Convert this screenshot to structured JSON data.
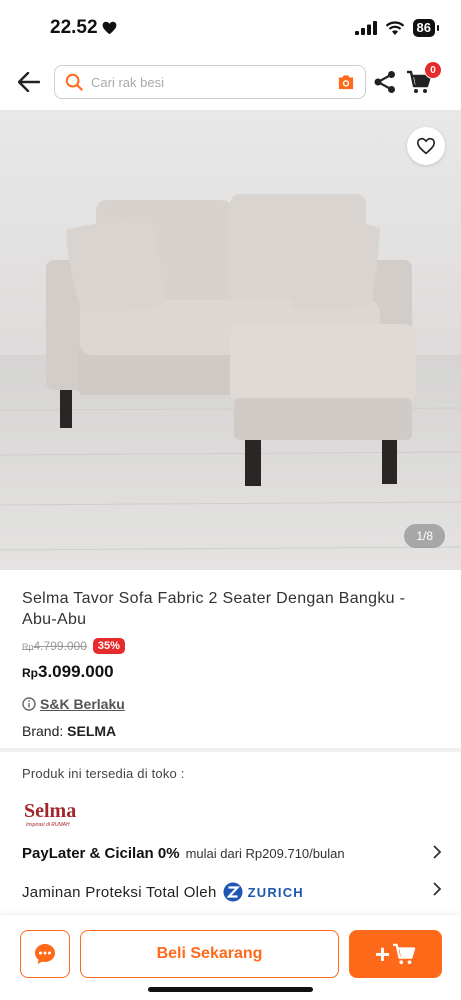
{
  "status_bar": {
    "time": "22.52",
    "battery": "86"
  },
  "header": {
    "search_placeholder": "Cari rak besi",
    "cart_count": "0"
  },
  "product": {
    "image_counter": "1/8",
    "title": "Selma Tavor Sofa Fabric 2 Seater Dengan Bangku - Abu-Abu",
    "old_price_currency": "Rp",
    "old_price": "4.799.000",
    "discount": "35%",
    "price_currency": "Rp",
    "price": "3.099.000",
    "tnc_label": "S&K Berlaku",
    "brand_label": "Brand: ",
    "brand_value": "SELMA"
  },
  "availability": {
    "label": "Produk ini tersedia di toko :",
    "store_name": "Selma",
    "store_tagline": "Inspirasi di RUMAH"
  },
  "paylater": {
    "title": "PayLater & Cicilan 0%",
    "detail": "mulai dari Rp209.710/bulan"
  },
  "protection": {
    "label": "Jaminan Proteksi Total Oleh",
    "partner": "ZURICH"
  },
  "bottom_bar": {
    "buy_label": "Beli Sekarang",
    "add_cart_label": "+"
  },
  "colors": {
    "accent": "#ff6a1a",
    "badge": "#e52b2b",
    "zurich": "#2056b3"
  }
}
